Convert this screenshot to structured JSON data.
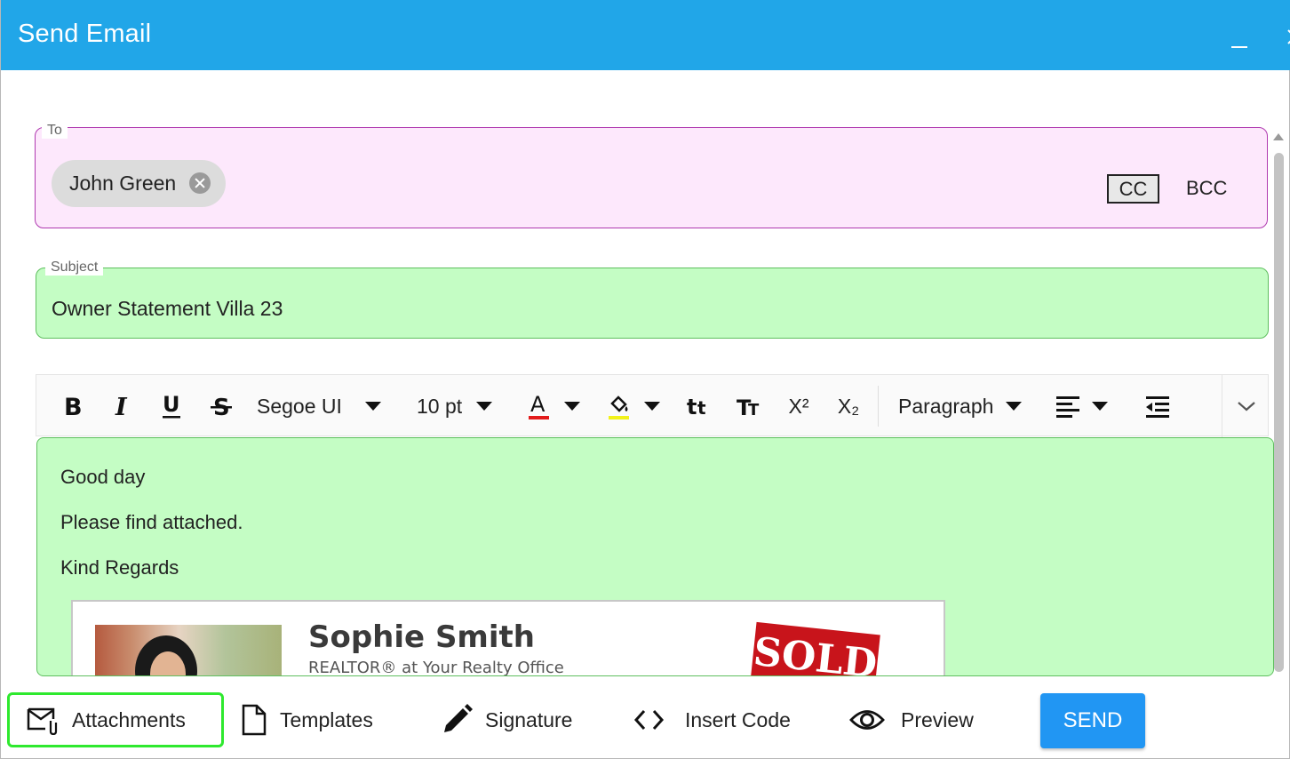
{
  "window": {
    "title": "Send Email"
  },
  "to": {
    "label": "To",
    "recipients": [
      {
        "name": "John Green"
      }
    ],
    "cc_label": "CC",
    "bcc_label": "BCC"
  },
  "subject": {
    "label": "Subject",
    "value": "Owner Statement Villa 23"
  },
  "toolbar": {
    "font_family": "Segoe UI",
    "font_size": "10 pt",
    "paragraph": "Paragraph",
    "superscript": "X²",
    "subscript": "X₂"
  },
  "body": {
    "lines": [
      "Good day",
      "Please find attached.",
      "Kind Regards"
    ],
    "signature": {
      "name": "Sophie Smith",
      "role": "REALTOR® at Your Realty Office",
      "sign_text": "SOLD"
    }
  },
  "actions": {
    "attachments": "Attachments",
    "templates": "Templates",
    "signature": "Signature",
    "insert_code": "Insert Code",
    "preview": "Preview",
    "send": "SEND"
  },
  "colors": {
    "title_bar": "#21a6e8",
    "to_background": "#fde8fc",
    "subject_background": "#c4fdc4",
    "send_button": "#2196f3",
    "attachments_highlight": "#2ee92e"
  }
}
